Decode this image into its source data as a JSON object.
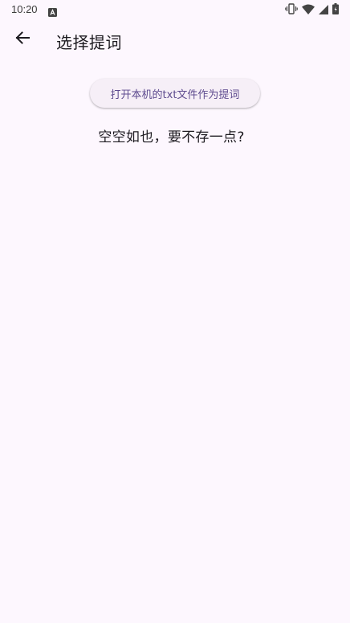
{
  "status_bar": {
    "time": "10:20",
    "icons": [
      "a-icon",
      "vibrate-icon",
      "wifi-icon",
      "signal-icon",
      "battery-icon"
    ]
  },
  "app_bar": {
    "back_icon": "arrow-back-icon",
    "title": "选择提词"
  },
  "main": {
    "open_button_label": "打开本机的txt文件作为提词",
    "empty_message": "空空如也，要不存一点?"
  },
  "colors": {
    "background": "#fdf7fe",
    "button_background": "#f6eff7",
    "button_text": "#5e4b8f",
    "text_primary": "#1d1b20"
  }
}
